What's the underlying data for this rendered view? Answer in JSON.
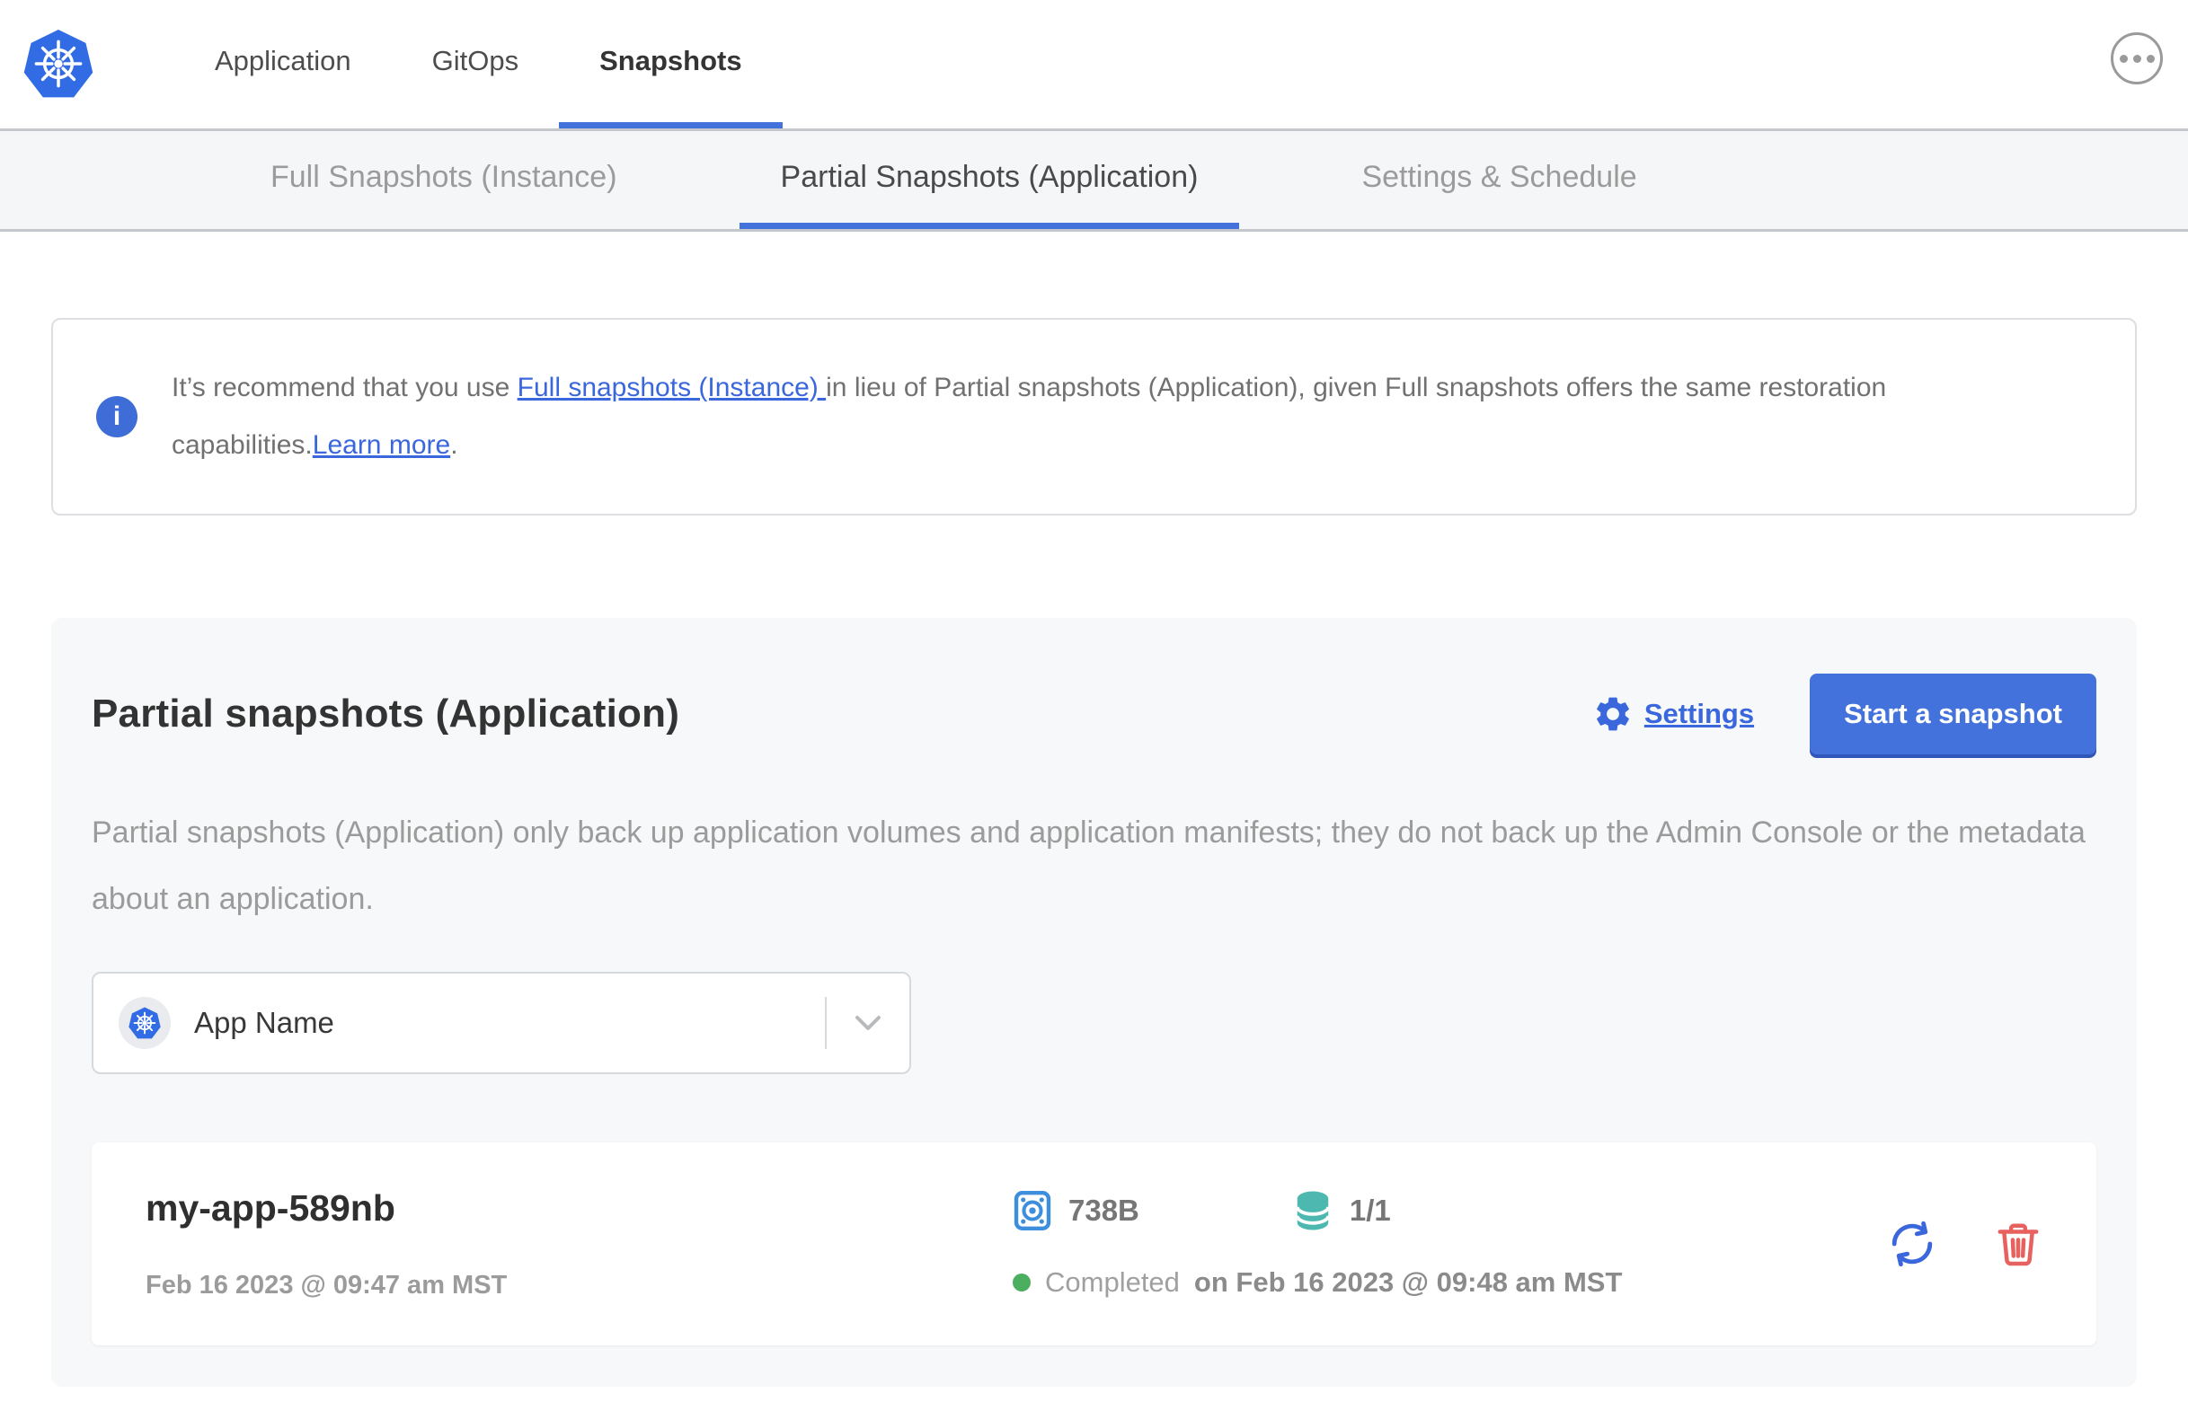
{
  "header": {
    "nav": [
      {
        "label": "Application"
      },
      {
        "label": "GitOps"
      },
      {
        "label": "Snapshots"
      }
    ]
  },
  "subnav": {
    "tabs": [
      {
        "label": "Full Snapshots (Instance)"
      },
      {
        "label": "Partial Snapshots (Application)"
      },
      {
        "label": "Settings & Schedule"
      }
    ]
  },
  "banner": {
    "icon_glyph": "i",
    "text_before_link": "It’s recommend that you use ",
    "link1": "Full snapshots (Instance) ",
    "text_middle": "in lieu of Partial snapshots (Application), given Full snapshots offers the same restoration capabilities.",
    "link2": "Learn more",
    "text_after": "."
  },
  "panel": {
    "title": "Partial snapshots (Application)",
    "settings_label": "Settings",
    "start_button_label": "Start a snapshot",
    "description": "Partial snapshots (Application) only back up application volumes and application manifests; they do not back up the Admin Console or the metadata about an application.",
    "app_selector": {
      "value": "App Name"
    },
    "snapshots": [
      {
        "name": "my-app-589nb",
        "started": "Feb 16 2023 @ 09:47 am MST",
        "size": "738B",
        "volumes": "1/1",
        "status": "Completed",
        "finished": "on Feb 16 2023 @ 09:48 am MST"
      }
    ]
  },
  "colors": {
    "accent": "#4472dc",
    "kubernetes_blue": "#326ce5",
    "hdd_icon_blue": "#3e8ede",
    "volumes_teal": "#4cb8af",
    "status_green": "#4cae5f",
    "delete_red": "#e7625f"
  }
}
